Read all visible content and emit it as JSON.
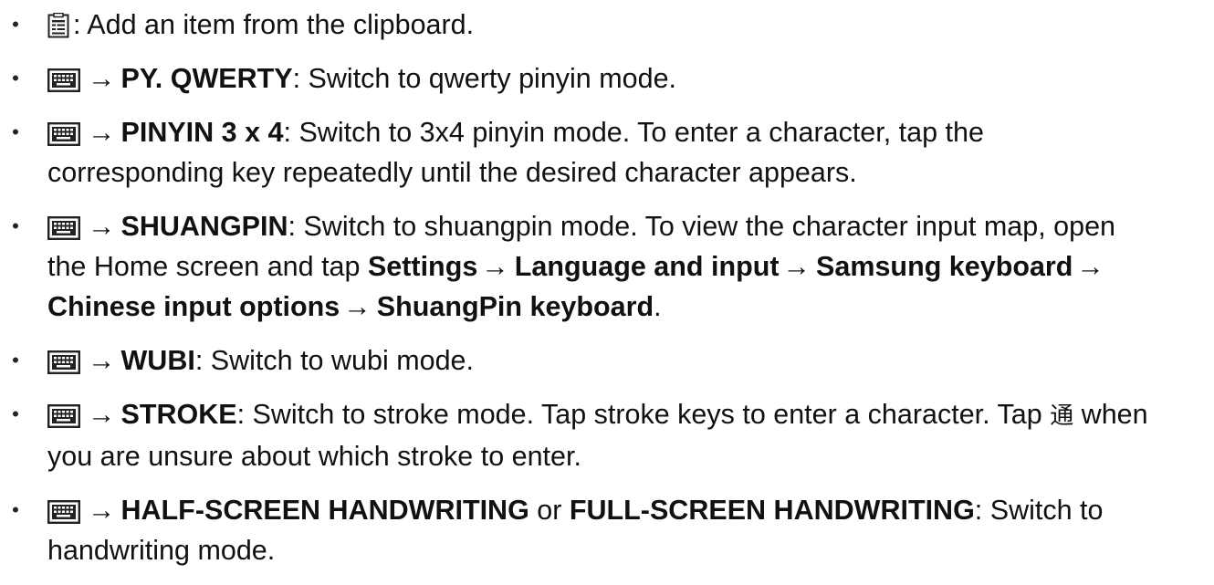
{
  "items": [
    {
      "icon": "clipboard-icon",
      "text": ": Add an item from the clipboard."
    },
    {
      "icon": "keyboard-icon",
      "arrow": "→",
      "bold": "PY. QWERTY",
      "text": ": Switch to qwerty pinyin mode."
    },
    {
      "icon": "keyboard-icon",
      "arrow": "→",
      "bold": "PINYIN 3 x 4",
      "text_line1": ": Switch to 3x4 pinyin mode. To enter a character, tap the",
      "text_line2": "corresponding key repeatedly until the desired character appears."
    },
    {
      "icon": "keyboard-icon",
      "arrow": "→",
      "bold": "SHUANGPIN",
      "text_line1": ": Switch to shuangpin mode. To view the character input map, open",
      "text_line2_pre": "the Home screen and tap ",
      "path": [
        "Settings",
        "Language and input",
        "Samsung keyboard",
        "Chinese input options",
        "ShuangPin keyboard"
      ],
      "path_arrow": "→",
      "end": "."
    },
    {
      "icon": "keyboard-icon",
      "arrow": "→",
      "bold": "WUBI",
      "text": ": Switch to wubi mode."
    },
    {
      "icon": "keyboard-icon",
      "arrow": "→",
      "bold": "STROKE",
      "text_line1_pre": ": Switch to stroke mode. Tap stroke keys to enter a character. Tap ",
      "glyph": "通",
      "text_line1_post": " when",
      "text_line2": "you are unsure about which stroke to enter."
    },
    {
      "icon": "keyboard-icon",
      "arrow": "→",
      "bold": "HALF-SCREEN HANDWRITING",
      "connector": " or ",
      "bold2": "FULL-SCREEN HANDWRITING",
      "text_line1": ": Switch to",
      "text_line2": "handwriting mode."
    }
  ],
  "bullet_char": "•"
}
